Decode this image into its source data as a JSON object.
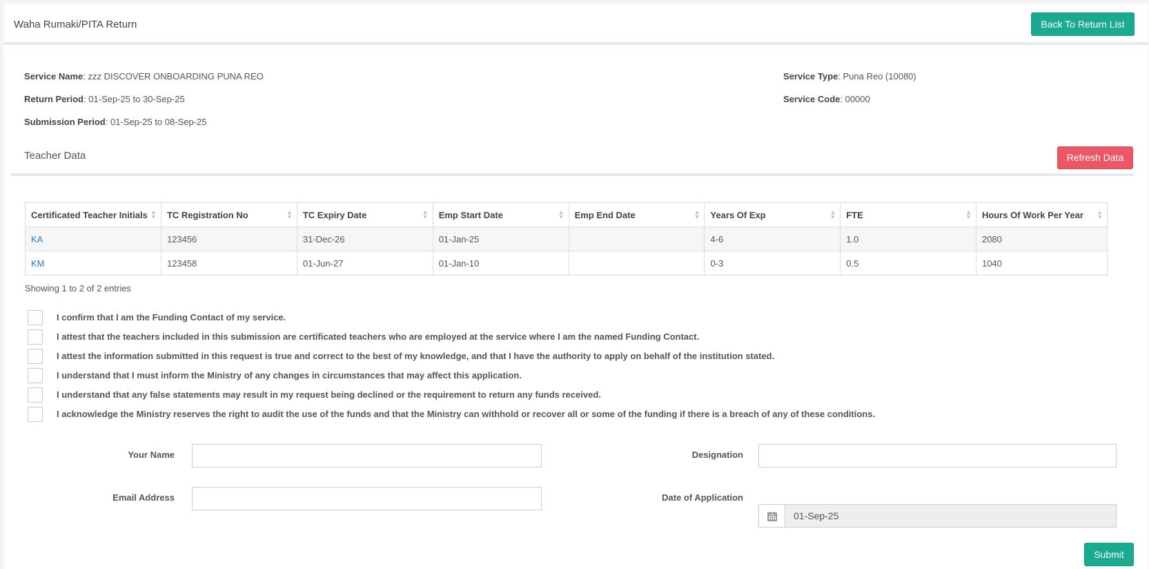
{
  "header": {
    "title": "Waha Rumaki/PITA Return",
    "back_label": "Back To Return List"
  },
  "service": {
    "name_label": "Service Name",
    "name_value": ": zzz DISCOVER ONBOARDING PUNA REO",
    "return_period_label": "Return Period",
    "return_period_value": ": 01-Sep-25 to 30-Sep-25",
    "submission_period_label": "Submission Period",
    "submission_period_value": ": 01-Sep-25 to 08-Sep-25",
    "type_label": "Service Type",
    "type_value": ": Puna Reo (10080)",
    "code_label": "Service Code",
    "code_value": ": 00000"
  },
  "teacher_section": {
    "title": "Teacher Data",
    "refresh_label": "Refresh Data"
  },
  "table": {
    "columns": [
      "Certificated Teacher Initials",
      "TC Registration No",
      "TC Expiry Date",
      "Emp Start Date",
      "Emp End Date",
      "Years Of Exp",
      "FTE",
      "Hours Of Work Per Year"
    ],
    "rows": [
      [
        "KA",
        "123456",
        "31-Dec-26",
        "01-Jan-25",
        "",
        "4-6",
        "1.0",
        "2080"
      ],
      [
        "KM",
        "123458",
        "01-Jun-27",
        "01-Jan-10",
        "",
        "0-3",
        "0.5",
        "1040"
      ]
    ],
    "showing": "Showing 1 to 2 of 2 entries"
  },
  "declarations": [
    "I confirm that I am the Funding Contact of my service.",
    "I attest that the teachers included in this submission are certificated teachers who are employed at the service where I am the named Funding Contact.",
    "I attest the information submitted in this request is true and correct to the best of my knowledge, and that I have the authority to apply on behalf of the institution stated.",
    "I understand that I must inform the Ministry of any changes in circumstances that may affect this application.",
    "I understand that any false statements may result in my request being declined or the requirement to return any funds received.",
    "I acknowledge the Ministry reserves the right to audit the use of the funds and that the Ministry can withhold or recover all or some of the funding if there is a breach of any of these conditions."
  ],
  "form": {
    "your_name_label": "Your Name",
    "your_name_value": "",
    "designation_label": "Designation",
    "designation_value": "",
    "email_label": "Email Address",
    "email_value": "",
    "date_label": "Date of Application",
    "date_value": "01-Sep-25",
    "submit_label": "Submit"
  },
  "colors": {
    "accent_teal": "#1aaa8f",
    "refresh_red": "#ec5765",
    "link_blue": "#2a78c8"
  },
  "icons": {
    "date_addon": "calendar-icon",
    "sort": "sort-icon"
  }
}
